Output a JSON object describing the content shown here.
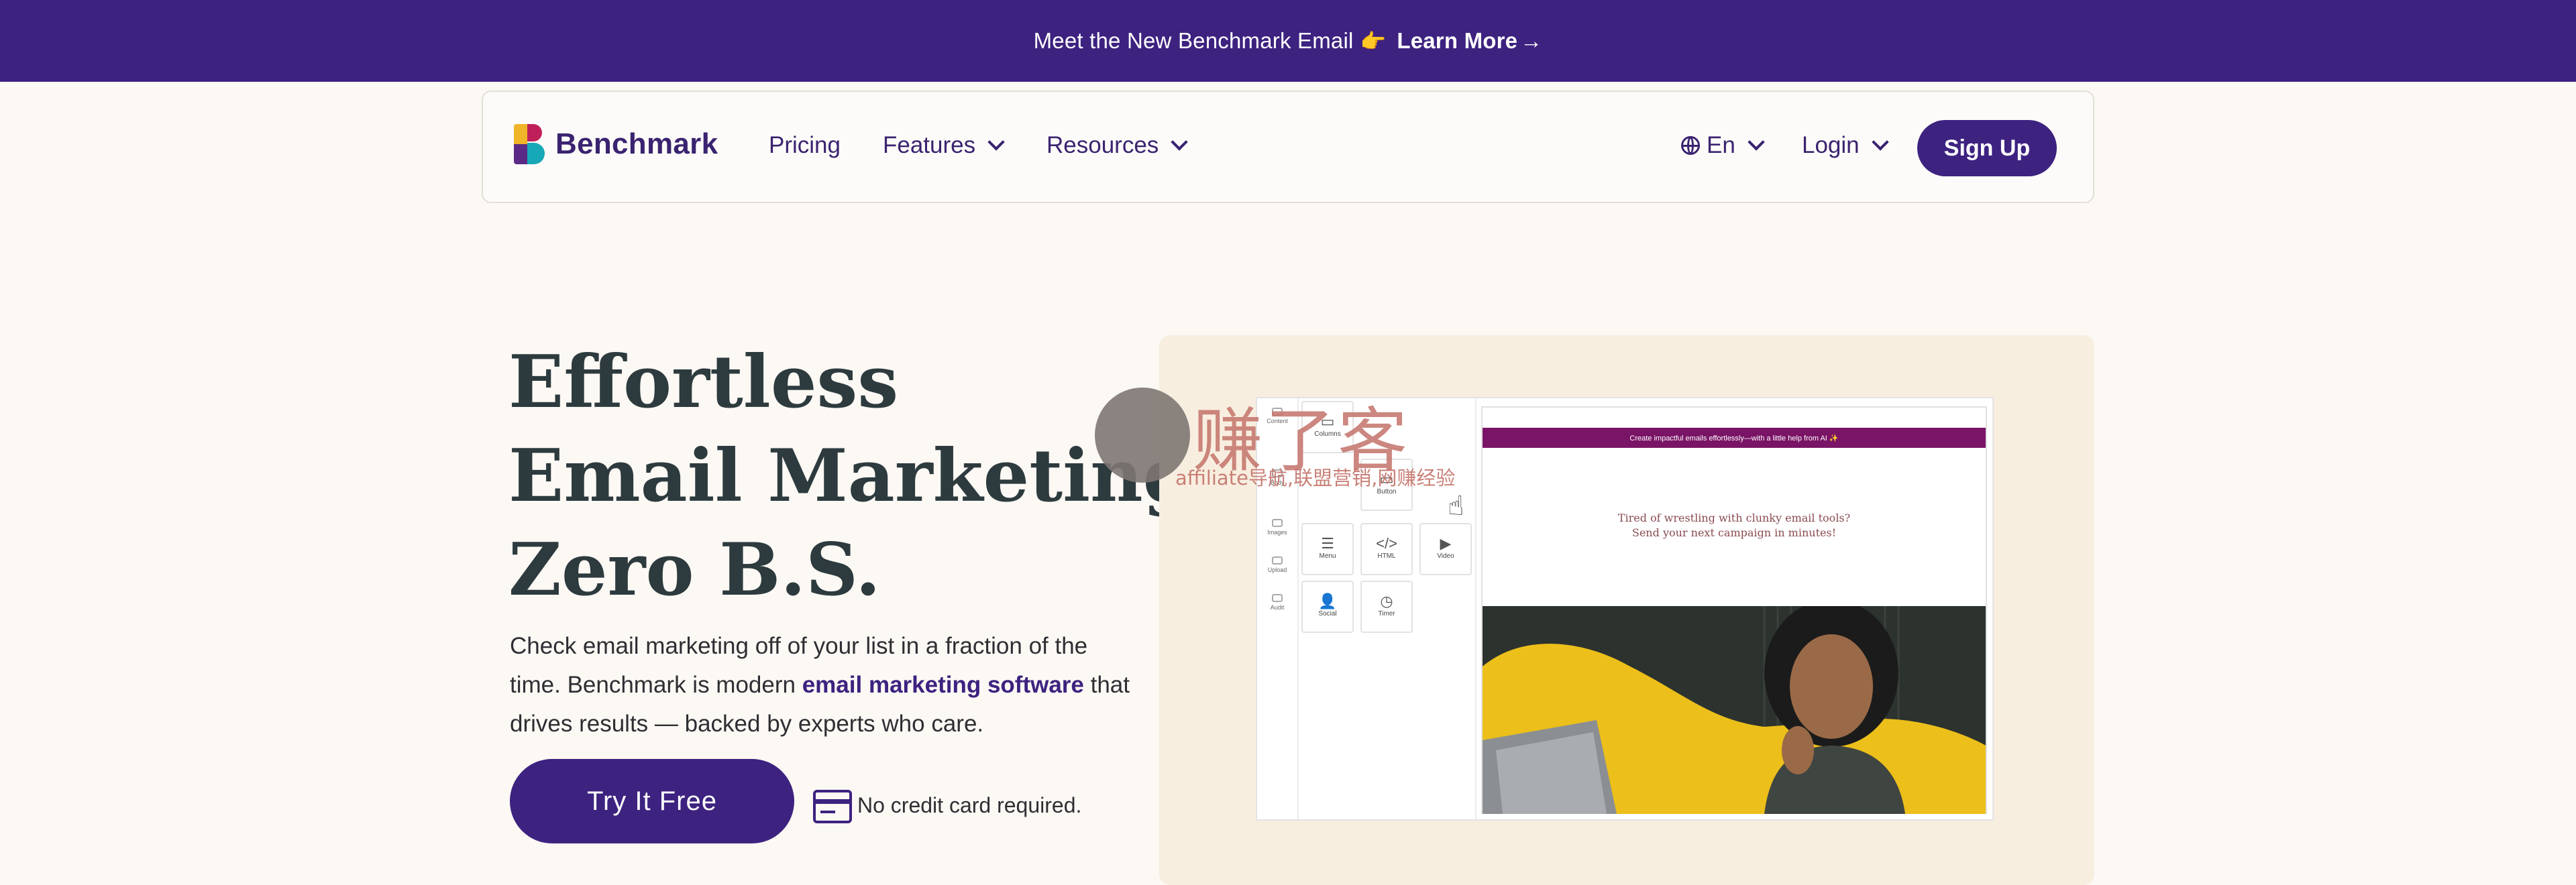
{
  "announcement": {
    "text": "Meet the New Benchmark Email",
    "emoji": "👉",
    "link_label": "Learn More",
    "arrow": "→"
  },
  "brand": {
    "name": "Benchmark"
  },
  "nav": {
    "items": [
      "Pricing",
      "Features",
      "Resources"
    ],
    "language": "En",
    "login": "Login",
    "signup": "Sign Up"
  },
  "hero": {
    "title_lines": [
      "Effortless",
      "Email Marketing.",
      "Zero B.S."
    ],
    "desc_before": "Check email marketing off of your list in a fraction of the time. Benchmark is modern ",
    "desc_link": "email marketing software",
    "desc_after": " that drives results — backed by experts who care.",
    "cta": "Try It Free",
    "note": "No credit card required."
  },
  "mockup": {
    "rail": [
      "Content",
      "Columns",
      "Body",
      "Images",
      "Upload",
      "Audit"
    ],
    "blocks": [
      {
        "label": "Columns",
        "icon": "▭"
      },
      {
        "label": "Button",
        "icon": "▭"
      },
      {
        "label": "Menu",
        "icon": "☰"
      },
      {
        "label": "HTML",
        "icon": "</>"
      },
      {
        "label": "Video",
        "icon": "▶"
      },
      {
        "label": "Social",
        "icon": "👤"
      },
      {
        "label": "Timer",
        "icon": "◷"
      }
    ],
    "email_header": "Create impactful emails effortlessly—with a little help from AI ✨",
    "email_text": "Tired of wrestling with clunky email tools? Send your next campaign in minutes!"
  },
  "watermark": {
    "title": "赚了客",
    "subtitle": "affiliate导航,联盟营销,网赚经验"
  },
  "colors": {
    "brand_purple": "#3d2280",
    "page_bg": "#fcf8f4",
    "heading": "#2d3a3e",
    "email_header": "#7a1466",
    "accent_yellow": "#f0c01a"
  }
}
